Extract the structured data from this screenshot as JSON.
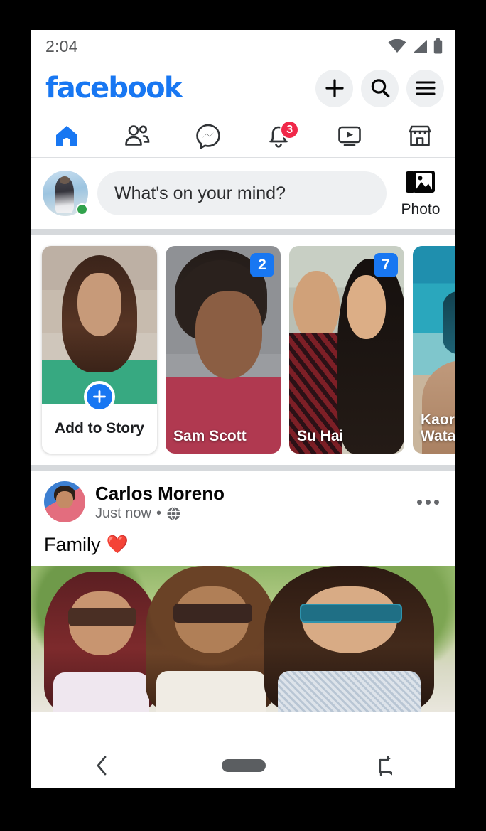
{
  "statusbar": {
    "time": "2:04",
    "icons": [
      "wifi-icon",
      "cellular-signal-icon",
      "battery-icon"
    ]
  },
  "header": {
    "brand": "facebook",
    "brand_color": "#1877F2",
    "actions": [
      {
        "name": "create-button",
        "icon": "plus-icon"
      },
      {
        "name": "search-button",
        "icon": "search-icon"
      },
      {
        "name": "menu-button",
        "icon": "hamburger-menu-icon"
      }
    ]
  },
  "tabs": [
    {
      "label": "Home",
      "icon": "home-icon",
      "active": true,
      "badge": null
    },
    {
      "label": "Friends",
      "icon": "friends-icon",
      "active": false,
      "badge": null
    },
    {
      "label": "Messenger",
      "icon": "messenger-icon",
      "active": false,
      "badge": null
    },
    {
      "label": "Notifications",
      "icon": "bell-icon",
      "active": false,
      "badge": "3"
    },
    {
      "label": "Watch",
      "icon": "video-icon",
      "active": false,
      "badge": null
    },
    {
      "label": "Marketplace",
      "icon": "marketplace-icon",
      "active": false,
      "badge": null
    }
  ],
  "composer": {
    "avatar_name": "user-avatar",
    "online": true,
    "placeholder": "What's on your mind?",
    "photo_label": "Photo",
    "photo_icon": "photo-stack-icon"
  },
  "stories": [
    {
      "type": "add",
      "label": "Add to Story",
      "icon": "plus-icon",
      "badge": null,
      "art": "ph-woman1"
    },
    {
      "type": "story",
      "label": "Sam Scott",
      "badge": "2",
      "art": "ph-man"
    },
    {
      "type": "story",
      "label": "Su Hai",
      "badge": "7",
      "art": "ph-couple"
    },
    {
      "type": "story",
      "label": "Kaori Watanabe",
      "badge": null,
      "art": "ph-dive"
    }
  ],
  "post": {
    "author": "Carlos Moreno",
    "time": "Just now",
    "separator": "•",
    "audience_icon": "globe-public-icon",
    "menu_icon": "more-options-icon",
    "text": "Family",
    "emoji": "❤️",
    "photo_alt": "three-women-sunglasses-photo"
  },
  "navbar": {
    "back_icon": "back-chevron-icon",
    "home_icon": "home-pill-icon",
    "rotate_icon": "screen-rotate-icon"
  },
  "colors": {
    "fb_blue": "#1877F2",
    "badge_red": "#F02849",
    "online_green": "#31A24C",
    "surface": "#FFFFFF",
    "divider": "#D6D9DC"
  }
}
